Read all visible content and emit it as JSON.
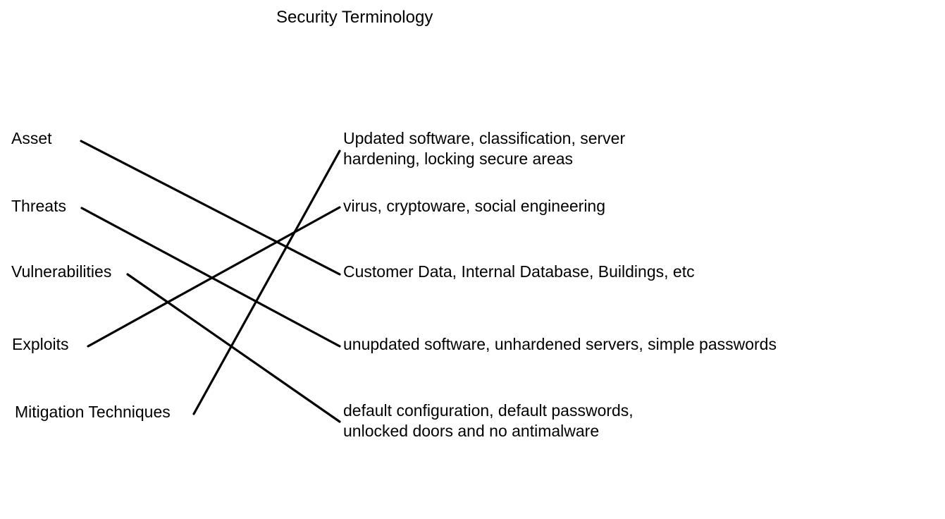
{
  "title": "Security Terminology",
  "terms": [
    {
      "id": "asset",
      "label": "Asset"
    },
    {
      "id": "threats",
      "label": "Threats"
    },
    {
      "id": "vulnerabilities",
      "label": "Vulnerabilities"
    },
    {
      "id": "exploits",
      "label": "Exploits"
    },
    {
      "id": "mitigation",
      "label": "Mitigation Techniques"
    }
  ],
  "definitions": [
    {
      "id": "mitigation-def",
      "lines": [
        "Updated software, classification, server",
        "hardening, locking secure areas"
      ]
    },
    {
      "id": "exploits-def",
      "lines": [
        "virus, cryptoware, social engineering"
      ]
    },
    {
      "id": "asset-def",
      "lines": [
        "Customer Data, Internal Database, Buildings, etc"
      ]
    },
    {
      "id": "threats-def",
      "lines": [
        "unupdated software, unhardened servers, simple passwords"
      ]
    },
    {
      "id": "vulnerabilities-def",
      "lines": [
        "default configuration, default passwords,",
        "unlocked doors and no antimalware"
      ]
    }
  ],
  "links": [
    {
      "from": "asset",
      "to": "asset-def"
    },
    {
      "from": "threats",
      "to": "threats-def"
    },
    {
      "from": "vulnerabilities",
      "to": "vulnerabilities-def"
    },
    {
      "from": "exploits",
      "to": "exploits-def"
    },
    {
      "from": "mitigation",
      "to": "mitigation-def"
    }
  ],
  "colors": {
    "text": "#000000",
    "line": "#000000",
    "background": "#ffffff"
  }
}
